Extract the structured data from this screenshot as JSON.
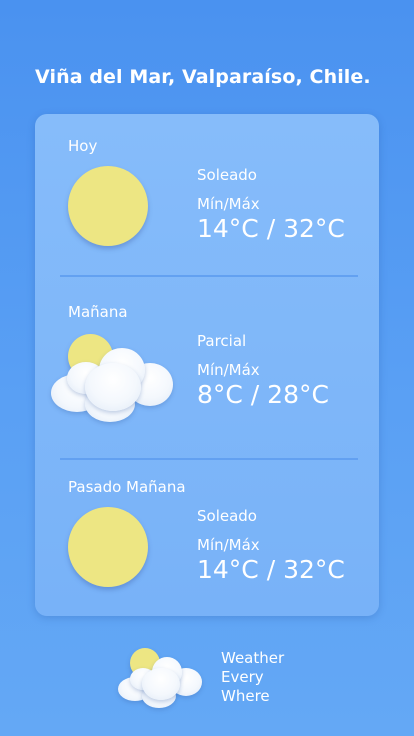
{
  "header": {
    "location": "Viña del Mar, Valparaíso, Chile."
  },
  "days": [
    {
      "label": "Hoy",
      "condition": "Soleado",
      "minmax_label": "Mín/Máx",
      "temps": "14°C / 32°C",
      "icon": "sun-icon"
    },
    {
      "label": "Mañana",
      "condition": "Parcial",
      "minmax_label": "Mín/Máx",
      "temps": "8°C / 28°C",
      "icon": "partly-cloudy-icon"
    },
    {
      "label": "Pasado Mañana",
      "condition": "Soleado",
      "minmax_label": "Mín/Máx",
      "temps": "14°C / 32°C",
      "icon": "sun-icon"
    }
  ],
  "footer": {
    "line1": "Weather",
    "line2": "Every",
    "line3": "Where",
    "icon": "partly-cloudy-icon"
  },
  "colors": {
    "background": "#4a92f0",
    "card": "#86bcfa",
    "sun": "#ede683",
    "cloud": "#ffffff"
  }
}
